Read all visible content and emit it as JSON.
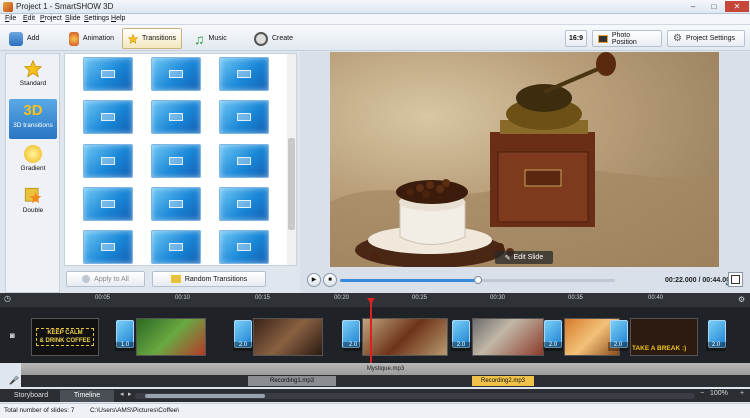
{
  "window": {
    "title": "Project 1 - SmartSHOW 3D",
    "min": "–",
    "max": "□",
    "close": "✕"
  },
  "menu": [
    "File",
    "Edit",
    "Project",
    "Slide",
    "Settings",
    "Help"
  ],
  "toolbar": {
    "tabs": [
      {
        "label": "Add",
        "icon": "folder-add-icon"
      },
      {
        "label": "Animation",
        "icon": "palette-icon"
      },
      {
        "label": "Transitions",
        "icon": "star-icon"
      },
      {
        "label": "Music",
        "icon": "music-note-icon"
      },
      {
        "label": "Create",
        "icon": "film-reel-icon"
      }
    ],
    "aspect": "16:9",
    "photo_position": "Photo Position",
    "project_settings": "Project Settings"
  },
  "categories": [
    {
      "label": "Standard"
    },
    {
      "label": "3D transitions",
      "glyph": "3D"
    },
    {
      "label": "Gradient"
    },
    {
      "label": "Double"
    }
  ],
  "transitions_panel": {
    "apply_all": "Apply to All",
    "random": "Random Transitions"
  },
  "preview": {
    "edit_slide": "Edit Slide",
    "time": "00:22.000 / 00:44.000",
    "progress": 0.5
  },
  "timeline": {
    "ticks": [
      "00:05",
      "00:10",
      "00:15",
      "00:20",
      "00:25",
      "00:30",
      "00:35",
      "00:40"
    ],
    "slide_durations": [
      "1.0",
      "2.0",
      "2.0",
      "2.0",
      "2.0",
      "2.0",
      "2.0"
    ],
    "transition_durations": [
      "2.0",
      "2.0",
      "2.0",
      "2.0",
      "2.0"
    ],
    "slide1_text": [
      "KEEP CALM",
      "& DRINK COFFEE"
    ],
    "slide7_text": "TAKE A BREAK :)",
    "music_track": "Mystique.mp3",
    "recordings": [
      "Recording1.mp3",
      "Recording2.mp3"
    ],
    "zoom": "100%"
  },
  "tabs": [
    "Storyboard",
    "Timeline"
  ],
  "status": {
    "total": "Total number of slides: 7",
    "path": "C:\\Users\\AMS\\Pictures\\Coffee\\"
  }
}
